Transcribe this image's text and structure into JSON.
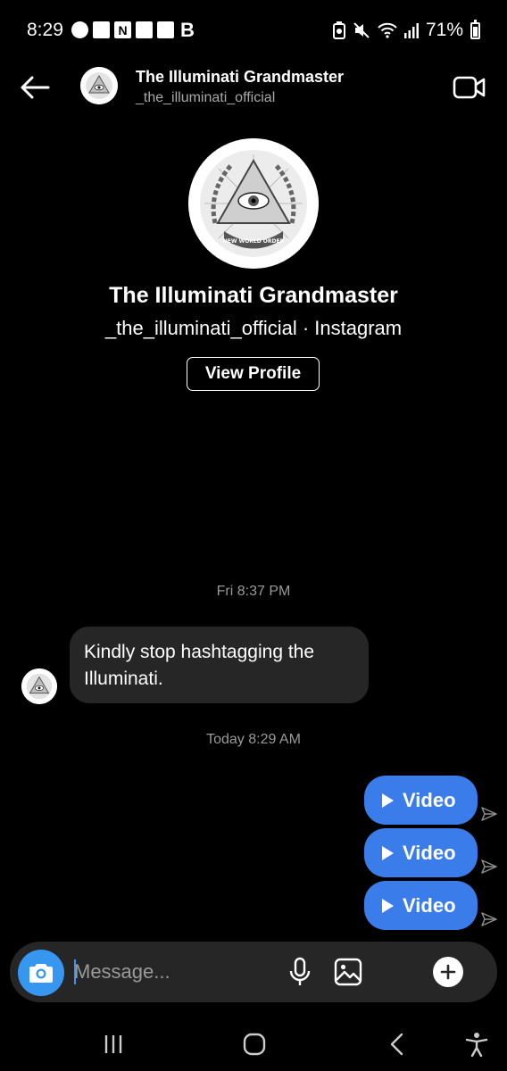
{
  "status_bar": {
    "time": "8:29",
    "battery": "71%",
    "notification_letter": "B",
    "icons": [
      "messenger-icon",
      "app-icon",
      "nfc-icon",
      "app-icon",
      "app-icon",
      "data-saver-icon",
      "mute-icon",
      "wifi-icon",
      "signal-icon",
      "battery-icon"
    ]
  },
  "header": {
    "name": "The Illuminati Grandmaster",
    "username": "_the_illuminati_official"
  },
  "profile": {
    "name": "The Illuminati Grandmaster",
    "subtitle": "_the_illuminati_official · Instagram",
    "button": "View Profile",
    "avatar_caption": "NEW WORLD ORDER"
  },
  "thread": {
    "timestamp_1": "Fri 8:37 PM",
    "received_message": "Kindly stop hashtagging the Illuminati.",
    "timestamp_2": "Today 8:29 AM",
    "sent": [
      {
        "label": "Video"
      },
      {
        "label": "Video"
      },
      {
        "label": "Video"
      }
    ]
  },
  "composer": {
    "placeholder": "Message..."
  },
  "colors": {
    "accent": "#3797f0",
    "bubble_sent": "#3a7dea",
    "bubble_received": "#262626",
    "background": "#000000"
  }
}
